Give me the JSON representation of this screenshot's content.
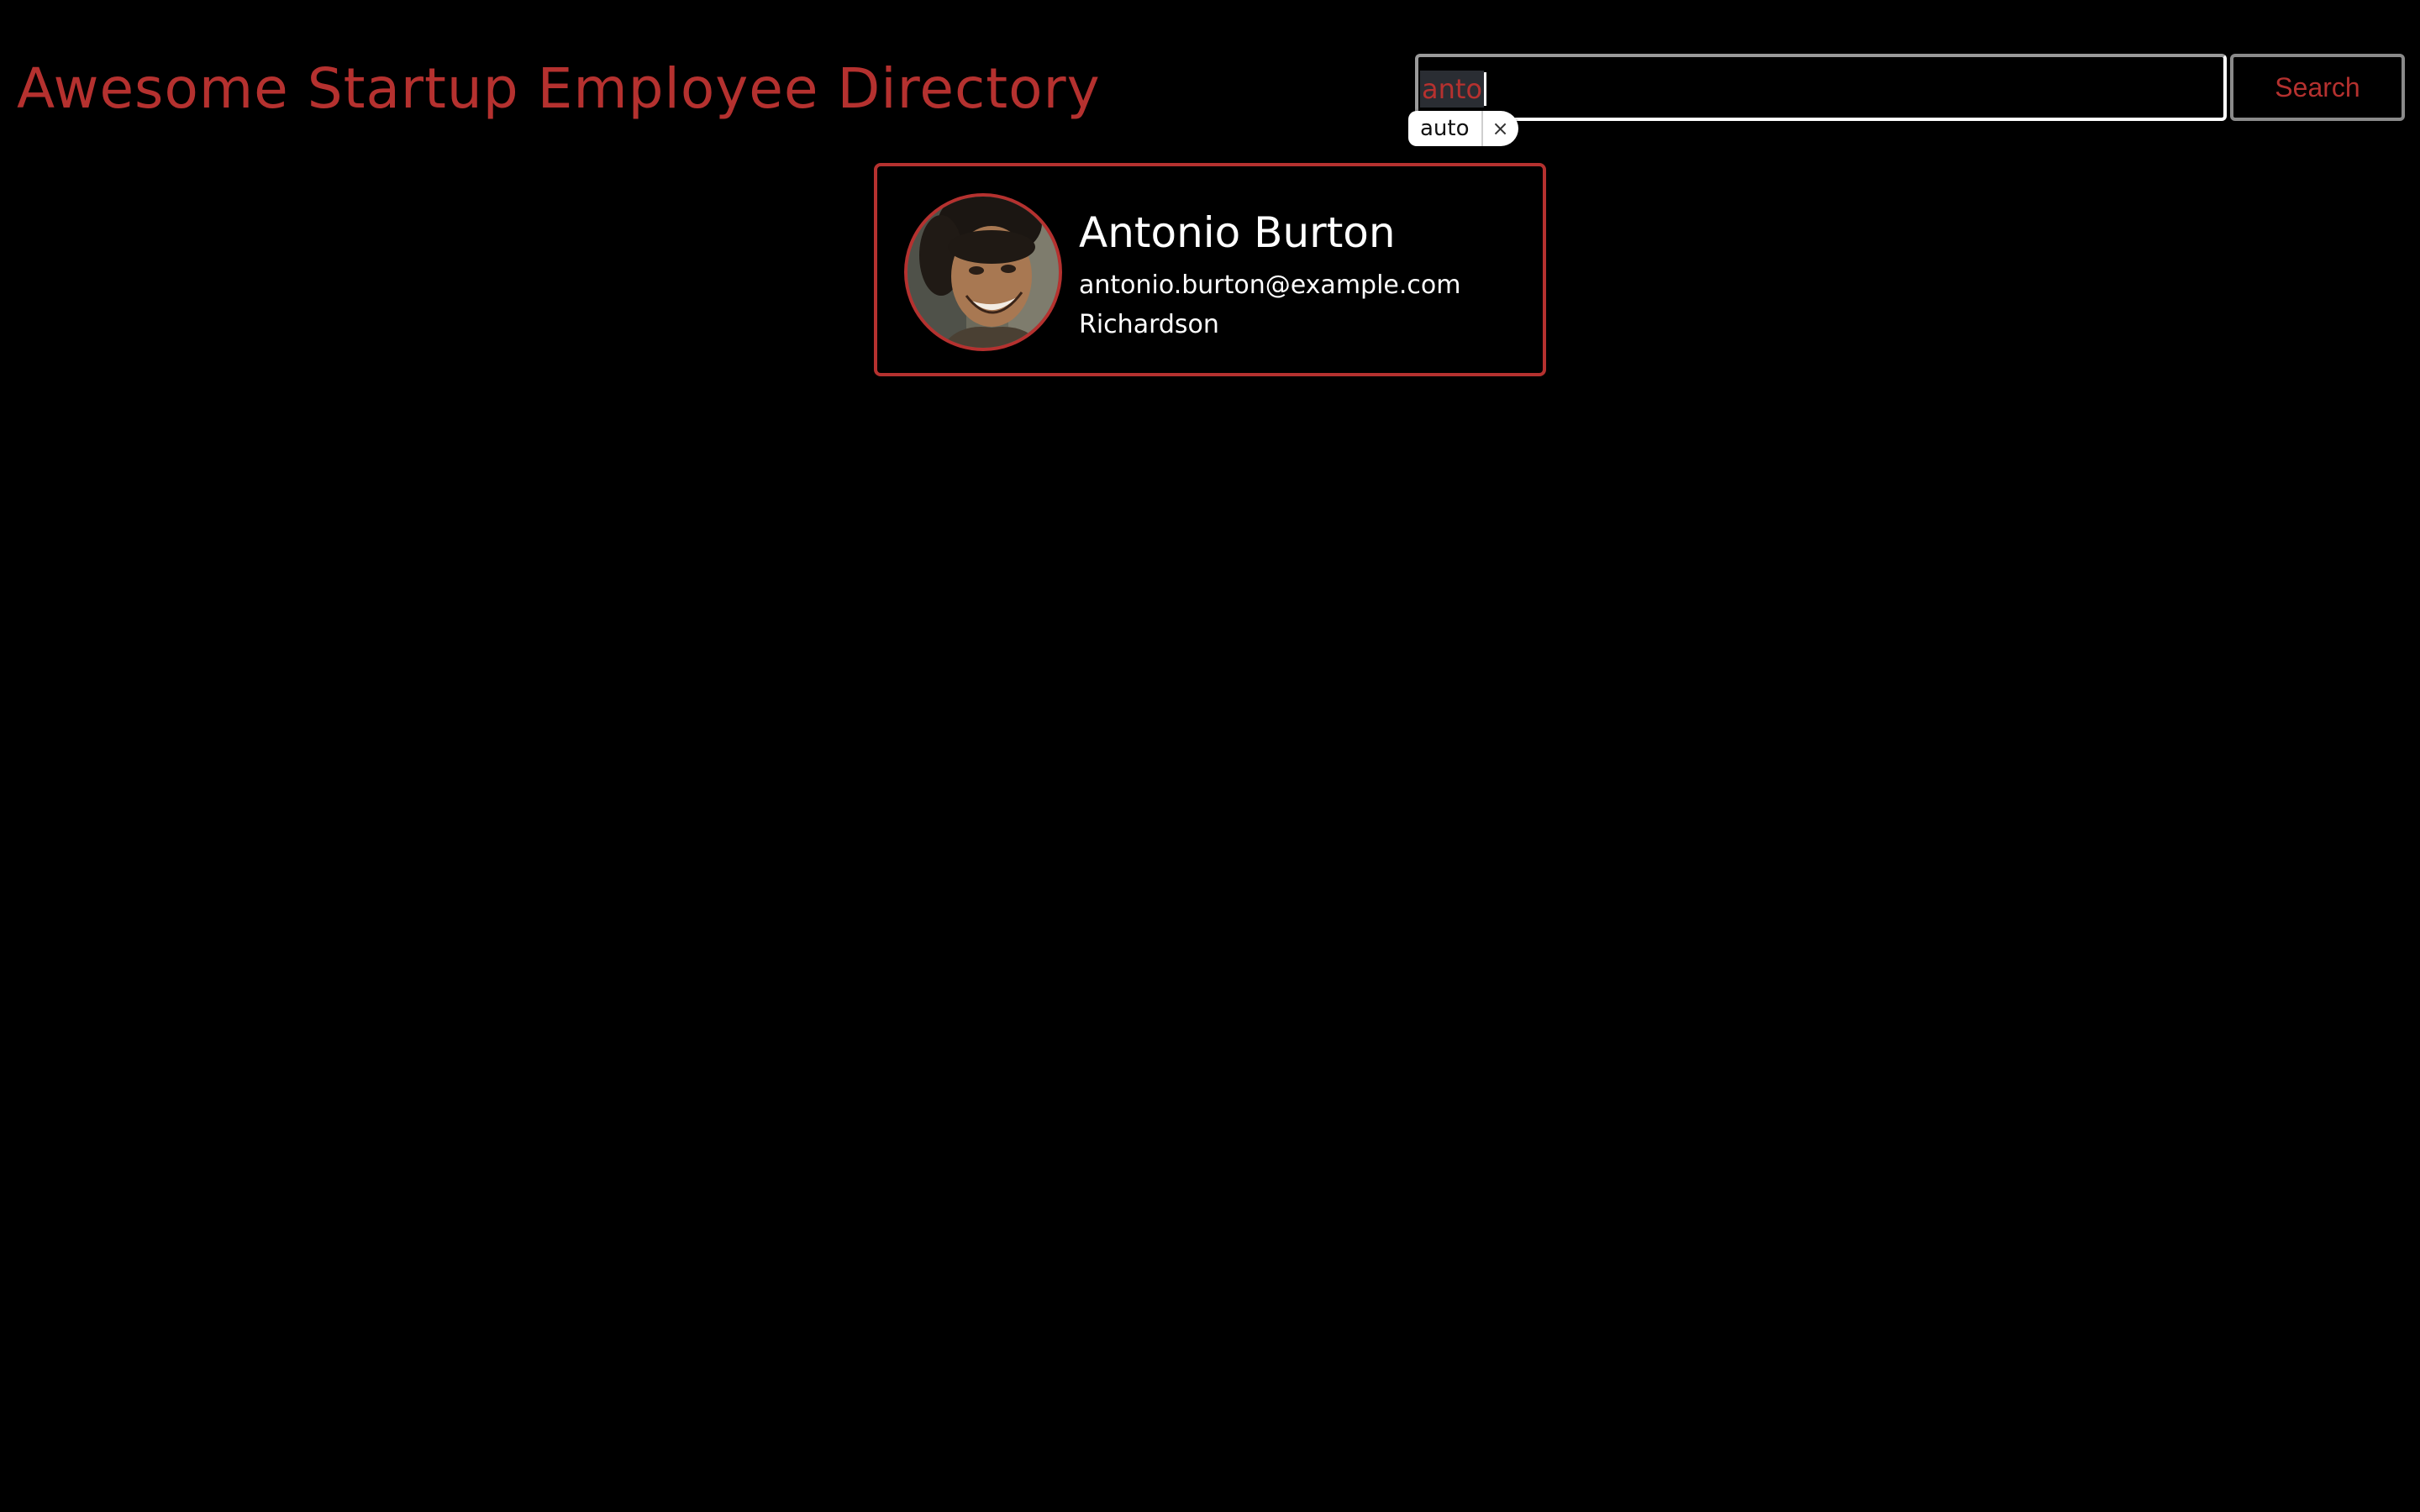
{
  "header": {
    "title": "Awesome Startup Employee Directory"
  },
  "search": {
    "value": "anto",
    "button_label": "Search"
  },
  "autofill": {
    "suggestion": "auto",
    "close_glyph": "×"
  },
  "employees": [
    {
      "name": "Antonio Burton",
      "email": "antonio.burton@example.com",
      "city": "Richardson"
    }
  ],
  "colors": {
    "background": "#000000",
    "accent": "#b5312f",
    "text": "#ffffff"
  }
}
